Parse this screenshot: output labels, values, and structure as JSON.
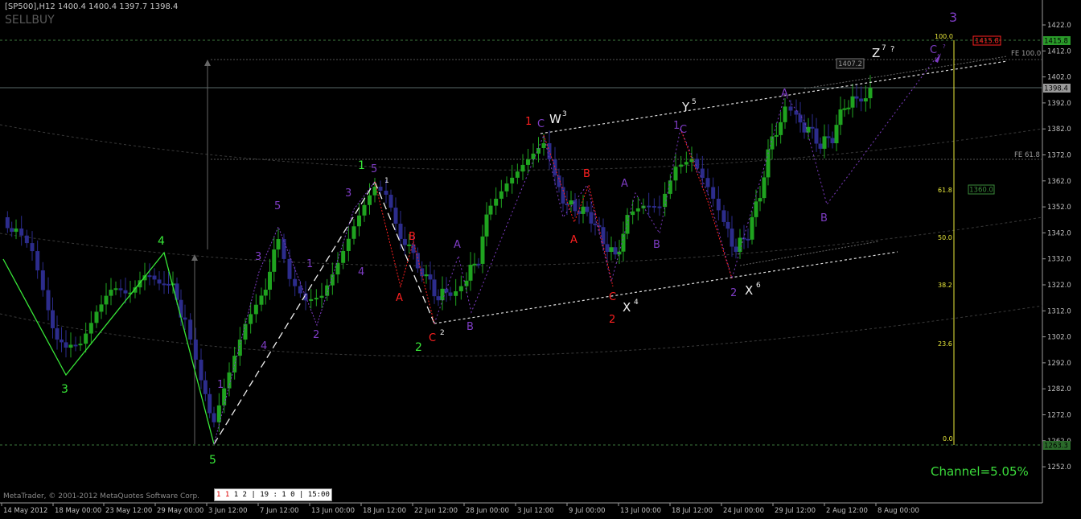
{
  "header": {
    "symbol": "[SP500],H12",
    "ohlc": "1400.4 1400.4 1397.7 1398.4",
    "indicator": "SELLBUY"
  },
  "footer": {
    "copyright": "MetaTrader, © 2001-2012 MetaQuotes Software Corp.",
    "time_box_prefix": "1 1 ",
    "time_box_rest": "1 2 | 19 : 1 0 | 15:00",
    "channel": "Channel=5.05%"
  },
  "price_axis": {
    "ticks": [
      "1422.0",
      "1412.0",
      "1402.0",
      "1392.0",
      "1382.0",
      "1372.0",
      "1362.0",
      "1352.0",
      "1342.0",
      "1332.0",
      "1322.0",
      "1312.0",
      "1302.0",
      "1292.0",
      "1282.0",
      "1272.0",
      "1262.0",
      "1252.0"
    ],
    "current_price": "1398.4",
    "green_level": "1415.8",
    "bottom_level": "1263.3"
  },
  "time_axis": {
    "ticks": [
      "14 May 2012",
      "18 May 00:00",
      "23 May 12:00",
      "29 May 00:00",
      "3 Jun 12:00",
      "7 Jun 12:00",
      "13 Jun 00:00",
      "18 Jun 12:00",
      "22 Jun 12:00",
      "28 Jun 00:00",
      "3 Jul 12:00",
      "9 Jul 00:00",
      "13 Jul 00:00",
      "18 Jul 12:00",
      "24 Jul 00:00",
      "29 Jul 12:00",
      "2 Aug 12:00",
      "8 Aug 00:00"
    ]
  },
  "fibo": {
    "levels": [
      "100.0",
      "61.8",
      "50.0",
      "38.2",
      "23.6",
      "0.0"
    ],
    "fe_100": "FE 100.0",
    "fe_618": "FE 61.8",
    "price_box_red": "1415.8",
    "price_box_green": "1360.0",
    "price_box_grey": "1407.2"
  },
  "wave_labels": {
    "green": [
      "1",
      "2",
      "3",
      "4",
      "5"
    ],
    "white_major": [
      "W",
      "X",
      "Y",
      "X",
      "Z",
      "?"
    ],
    "white_sup": [
      "3",
      "4",
      "5",
      "6",
      "7"
    ],
    "red": [
      "1",
      "2",
      "A",
      "B",
      "C",
      "A",
      "B",
      "C"
    ],
    "purple": [
      "1",
      "2",
      "3",
      "4",
      "5",
      "A",
      "B",
      "C",
      "A",
      "B",
      "C",
      "A",
      "B",
      "C"
    ],
    "top_right": "3",
    "small_white": [
      "1",
      "2"
    ]
  },
  "colors": {
    "background": "#000000",
    "bull_candle": "#1fa31f",
    "bear_candle": "#2c2c8c",
    "green_wave": "#38e838",
    "red_label": "#ff2020",
    "purple_label": "#7e3cc4",
    "fibo": "#e8e83a"
  }
}
